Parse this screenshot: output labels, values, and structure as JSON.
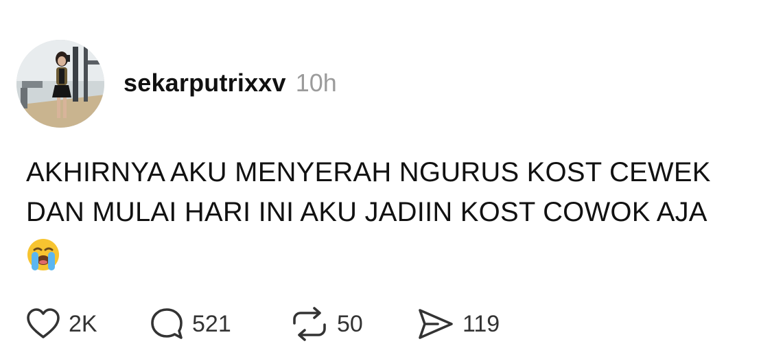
{
  "post": {
    "author": {
      "username": "sekarputrixxv",
      "avatar": "profile-photo"
    },
    "time_ago": "10h",
    "text_line_1": "AKHIRNYA AKU MENYERAH NGURUS KOST CEWEK",
    "text_line_2": "DAN MULAI HARI INI AKU JADIIN KOST COWOK AJA",
    "emoji": "loudly-crying-face"
  },
  "actions": {
    "like": {
      "icon": "heart-icon",
      "count": "2K"
    },
    "comment": {
      "icon": "comment-icon",
      "count": "521"
    },
    "repost": {
      "icon": "repost-icon",
      "count": "50"
    },
    "share": {
      "icon": "send-icon",
      "count": "119"
    }
  },
  "colors": {
    "text": "#111111",
    "muted": "#9b9b9b",
    "icon": "#333333"
  }
}
